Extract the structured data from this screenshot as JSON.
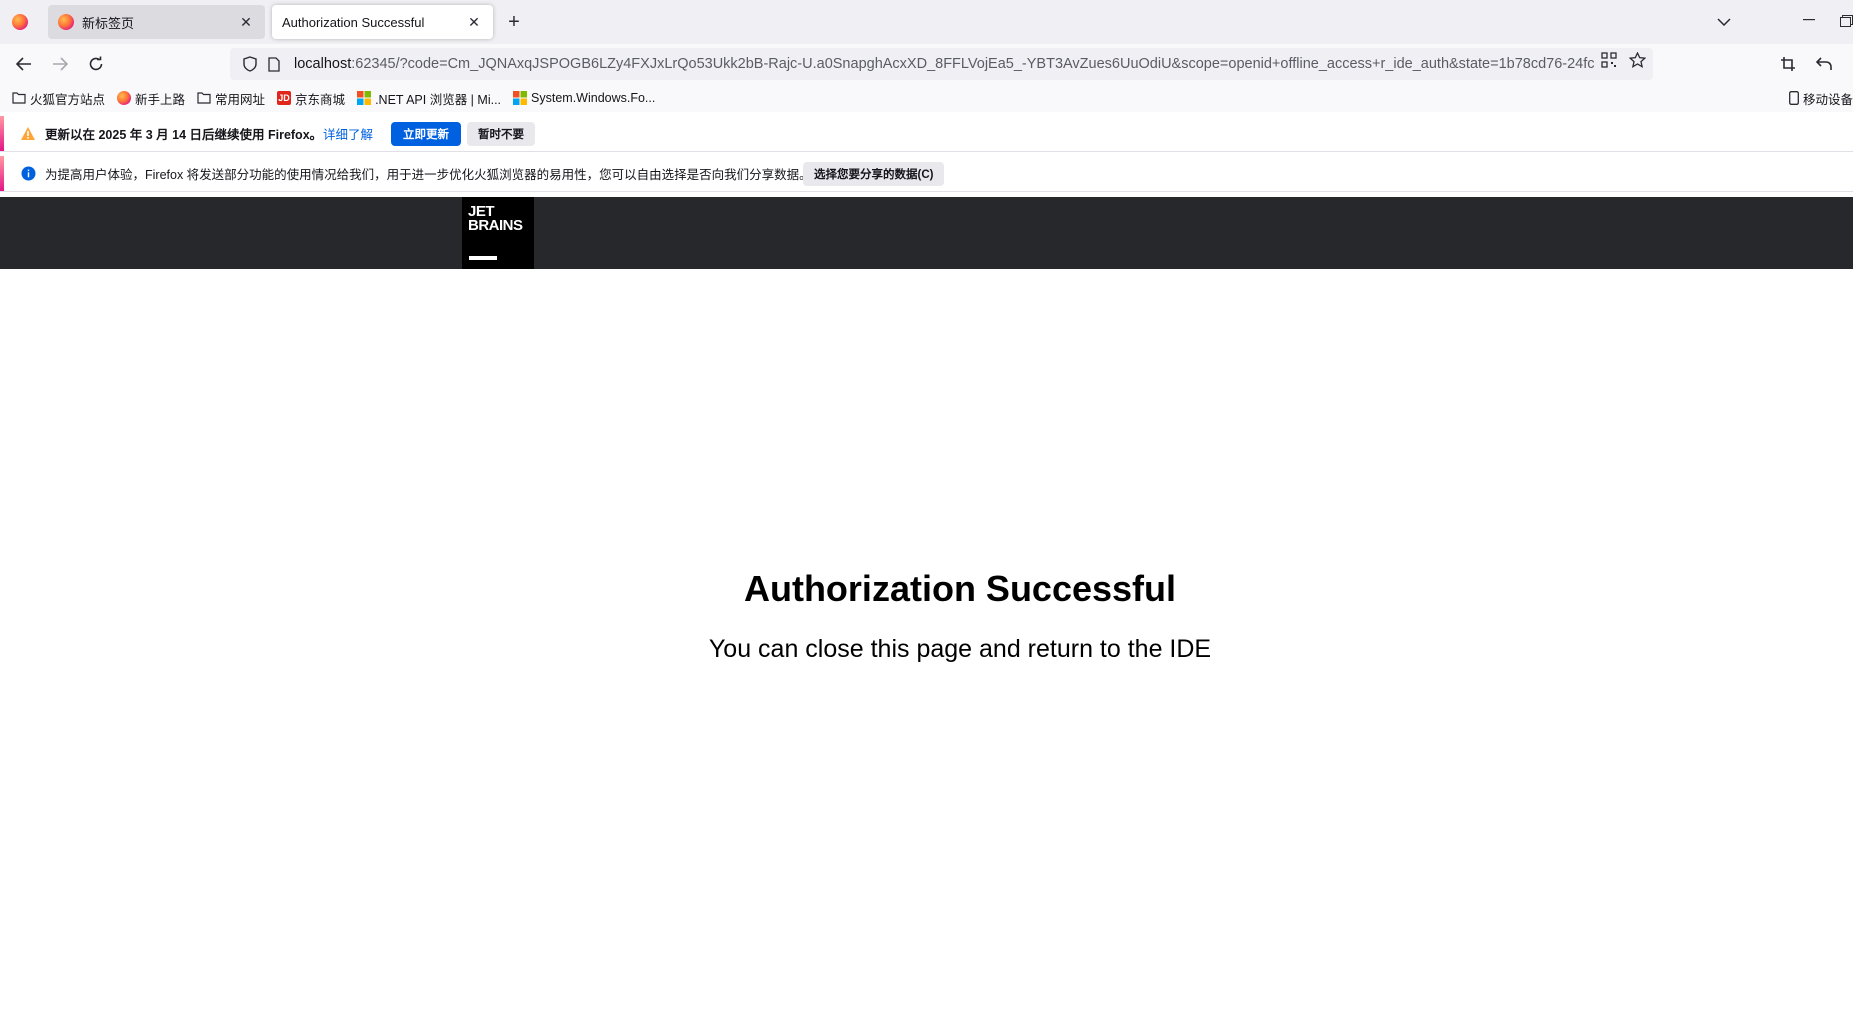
{
  "tabs": [
    {
      "title": "新标签页",
      "active": false
    },
    {
      "title": "Authorization Successful",
      "active": true
    }
  ],
  "url": {
    "host": "localhost",
    "rest": ":62345/?code=Cm_JQNAxqJSPOGB6LZy4FXJxLrQo53Ukk2bB-Rajc-U.a0SnapghAcxXD_8FFLVojEa5_-YBT3AvZues6UuOdiU&scope=openid+offline_access+r_ide_auth&state=1b78cd76-24fc"
  },
  "bookmarks": [
    {
      "label": "火狐官方站点",
      "icon": "folder-icon"
    },
    {
      "label": "新手上路",
      "icon": "firefox-icon"
    },
    {
      "label": "常用网址",
      "icon": "folder-icon"
    },
    {
      "label": "京东商城",
      "icon": "jd-icon"
    },
    {
      "label": ".NET API 浏览器 | Mi...",
      "icon": "microsoft-icon"
    },
    {
      "label": "System.Windows.Fo...",
      "icon": "microsoft-icon"
    }
  ],
  "mobile_bookmarks": "移动设备",
  "update_bar": {
    "message": "更新以在 2025 年 3 月 14 日后继续使用 Firefox。",
    "learn_more": "详细了解",
    "update_now": "立即更新",
    "not_now": "暂时不要"
  },
  "telemetry_bar": {
    "message": "为提高用户体验，Firefox 将发送部分功能的使用情况给我们，用于进一步优化火狐浏览器的易用性，您可以自由选择是否向我们分享数据。",
    "choose_button": "选择您要分享的数据(C)"
  },
  "logo": {
    "line1": "JET",
    "line2": "BRAINS"
  },
  "page": {
    "title": "Authorization Successful",
    "subtitle": "You can close this page and return to the IDE"
  },
  "colors": {
    "accent": "#0061e0",
    "header_bg": "#27282c"
  }
}
